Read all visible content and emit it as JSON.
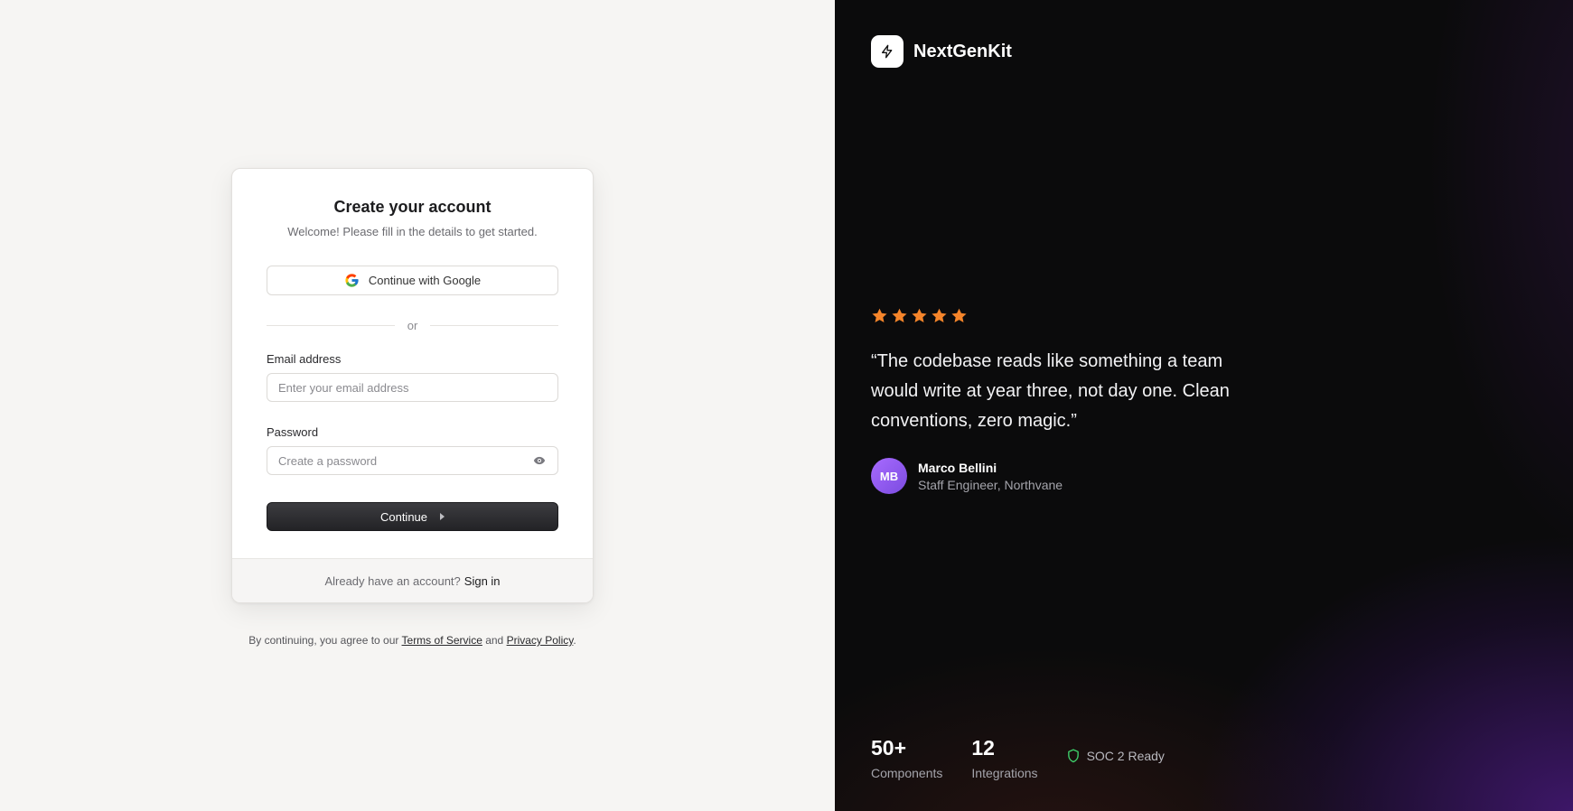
{
  "signup": {
    "title": "Create your account",
    "subtitle": "Welcome! Please fill in the details to get started.",
    "google_label": "Continue with Google",
    "divider": "or",
    "email_label": "Email address",
    "email_placeholder": "Enter your email address",
    "password_label": "Password",
    "password_placeholder": "Create a password",
    "continue_label": "Continue",
    "footer_text": "Already have an account?",
    "signin_label": "Sign in"
  },
  "legal": {
    "prefix": "By continuing, you agree to our ",
    "terms": "Terms of Service",
    "and": " and ",
    "privacy": "Privacy Policy",
    "suffix": "."
  },
  "brand": {
    "name": "NextGenKit",
    "icon": "lightning-icon"
  },
  "testimonial": {
    "rating": 5,
    "quote": "“The codebase reads like something a team would write at year three, not day one. Clean conventions, zero magic.”",
    "author_initials": "MB",
    "author_name": "Marco Bellini",
    "author_role": "Staff Engineer, Northvane"
  },
  "stats": [
    {
      "value": "50+",
      "label": "Components"
    },
    {
      "value": "12",
      "label": "Integrations"
    }
  ],
  "badge": {
    "label": "SOC 2 Ready",
    "icon": "shield-icon"
  },
  "colors": {
    "accent_star": "#f5852b",
    "primary_button": "#2d2d30",
    "avatar": "#9060f0",
    "shield": "#3ecf6a"
  }
}
